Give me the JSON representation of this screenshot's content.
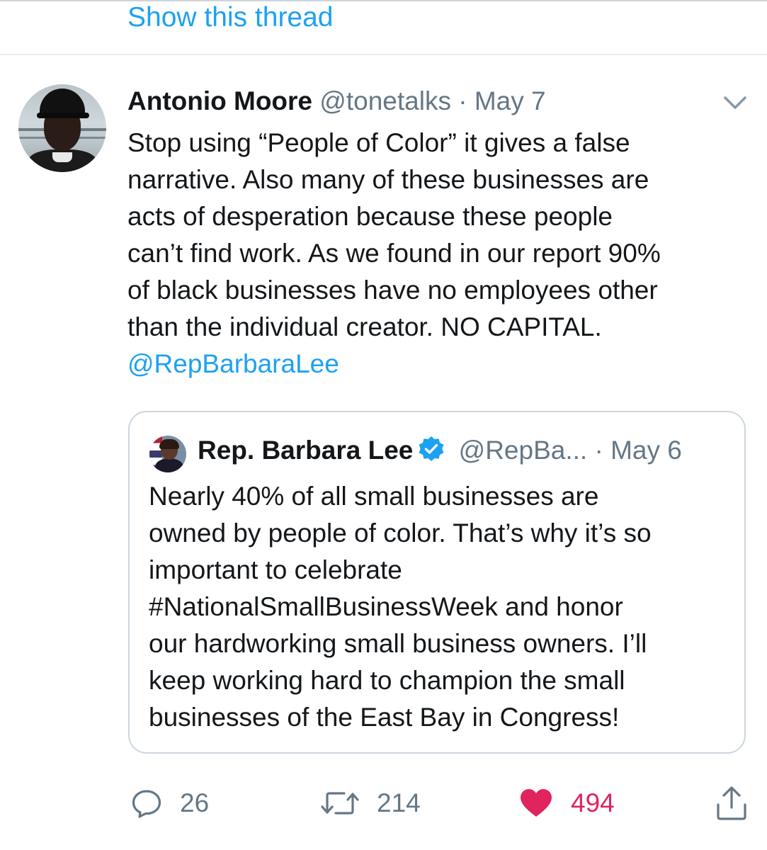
{
  "thread_link": "Show this thread",
  "tweet": {
    "author_name": "Antonio Moore",
    "handle": "@tonetalks",
    "separator": "·",
    "date": "May 7",
    "body_lines": [
      "Stop using “People of Color” it gives a false",
      "narrative. Also many of these businesses are",
      "acts of desperation because these people",
      "can’t find work. As we found in our report 90%",
      "of black businesses have no employees other",
      "than the individual creator. NO CAPITAL."
    ],
    "mention": "@RepBarbaraLee"
  },
  "quoted_tweet": {
    "author_name": "Rep. Barbara Lee",
    "verified": true,
    "handle": "@RepBa...",
    "separator": "·",
    "date": "May 6",
    "body_lines": [
      "Nearly 40% of all small businesses are",
      "owned by people of color. That’s why it’s so",
      "important to celebrate",
      "#NationalSmallBusinessWeek and honor",
      "our hardworking small business owners. I’ll",
      "keep working hard to champion the small",
      "businesses of the East Bay in Congress!"
    ]
  },
  "actions": {
    "reply_count": "26",
    "retweet_count": "214",
    "like_count": "494"
  },
  "icons": {
    "reply": "reply-icon",
    "retweet": "retweet-icon",
    "like": "heart-icon",
    "share": "share-icon",
    "caret": "chevron-down-icon",
    "verified": "verified-badge-icon"
  },
  "colors": {
    "link": "#1da1f2",
    "secondary_text": "#657786",
    "like": "#e0245e",
    "text": "#14171a"
  }
}
